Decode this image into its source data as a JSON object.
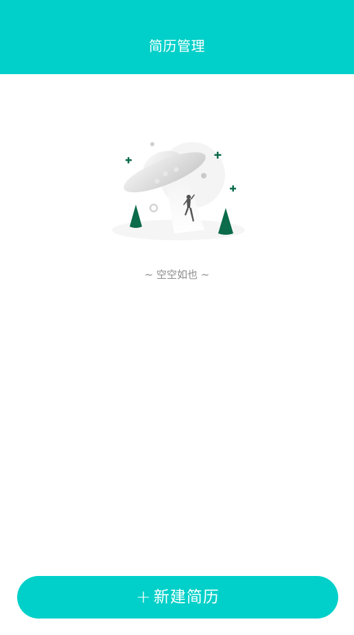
{
  "header": {
    "title": "简历管理"
  },
  "empty_state": {
    "illustration": "ufo-empty-illustration",
    "text": "~ 空空如也 ~"
  },
  "actions": {
    "new_resume_icon": "+",
    "new_resume_label": "新建简历"
  },
  "colors": {
    "accent": "#00d0c9",
    "tree_green": "#0b6b4a",
    "empty_text": "#8a8a8a"
  }
}
